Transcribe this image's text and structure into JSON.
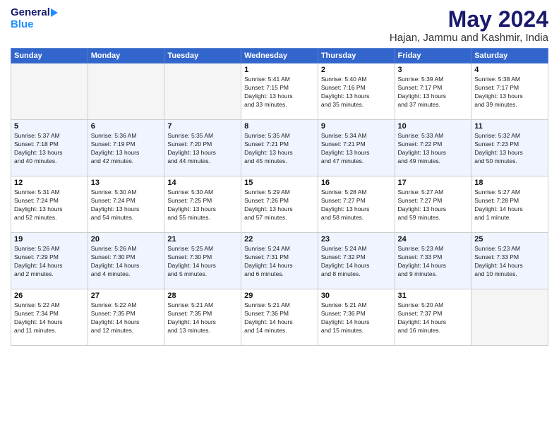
{
  "logo": {
    "general": "General",
    "blue": "Blue"
  },
  "title": "May 2024",
  "subtitle": "Hajan, Jammu and Kashmir, India",
  "weekdays": [
    "Sunday",
    "Monday",
    "Tuesday",
    "Wednesday",
    "Thursday",
    "Friday",
    "Saturday"
  ],
  "weeks": [
    [
      {
        "day": "",
        "info": ""
      },
      {
        "day": "",
        "info": ""
      },
      {
        "day": "",
        "info": ""
      },
      {
        "day": "1",
        "info": "Sunrise: 5:41 AM\nSunset: 7:15 PM\nDaylight: 13 hours\nand 33 minutes."
      },
      {
        "day": "2",
        "info": "Sunrise: 5:40 AM\nSunset: 7:16 PM\nDaylight: 13 hours\nand 35 minutes."
      },
      {
        "day": "3",
        "info": "Sunrise: 5:39 AM\nSunset: 7:17 PM\nDaylight: 13 hours\nand 37 minutes."
      },
      {
        "day": "4",
        "info": "Sunrise: 5:38 AM\nSunset: 7:17 PM\nDaylight: 13 hours\nand 39 minutes."
      }
    ],
    [
      {
        "day": "5",
        "info": "Sunrise: 5:37 AM\nSunset: 7:18 PM\nDaylight: 13 hours\nand 40 minutes."
      },
      {
        "day": "6",
        "info": "Sunrise: 5:36 AM\nSunset: 7:19 PM\nDaylight: 13 hours\nand 42 minutes."
      },
      {
        "day": "7",
        "info": "Sunrise: 5:35 AM\nSunset: 7:20 PM\nDaylight: 13 hours\nand 44 minutes."
      },
      {
        "day": "8",
        "info": "Sunrise: 5:35 AM\nSunset: 7:21 PM\nDaylight: 13 hours\nand 45 minutes."
      },
      {
        "day": "9",
        "info": "Sunrise: 5:34 AM\nSunset: 7:21 PM\nDaylight: 13 hours\nand 47 minutes."
      },
      {
        "day": "10",
        "info": "Sunrise: 5:33 AM\nSunset: 7:22 PM\nDaylight: 13 hours\nand 49 minutes."
      },
      {
        "day": "11",
        "info": "Sunrise: 5:32 AM\nSunset: 7:23 PM\nDaylight: 13 hours\nand 50 minutes."
      }
    ],
    [
      {
        "day": "12",
        "info": "Sunrise: 5:31 AM\nSunset: 7:24 PM\nDaylight: 13 hours\nand 52 minutes."
      },
      {
        "day": "13",
        "info": "Sunrise: 5:30 AM\nSunset: 7:24 PM\nDaylight: 13 hours\nand 54 minutes."
      },
      {
        "day": "14",
        "info": "Sunrise: 5:30 AM\nSunset: 7:25 PM\nDaylight: 13 hours\nand 55 minutes."
      },
      {
        "day": "15",
        "info": "Sunrise: 5:29 AM\nSunset: 7:26 PM\nDaylight: 13 hours\nand 57 minutes."
      },
      {
        "day": "16",
        "info": "Sunrise: 5:28 AM\nSunset: 7:27 PM\nDaylight: 13 hours\nand 58 minutes."
      },
      {
        "day": "17",
        "info": "Sunrise: 5:27 AM\nSunset: 7:27 PM\nDaylight: 13 hours\nand 59 minutes."
      },
      {
        "day": "18",
        "info": "Sunrise: 5:27 AM\nSunset: 7:28 PM\nDaylight: 14 hours\nand 1 minute."
      }
    ],
    [
      {
        "day": "19",
        "info": "Sunrise: 5:26 AM\nSunset: 7:29 PM\nDaylight: 14 hours\nand 2 minutes."
      },
      {
        "day": "20",
        "info": "Sunrise: 5:26 AM\nSunset: 7:30 PM\nDaylight: 14 hours\nand 4 minutes."
      },
      {
        "day": "21",
        "info": "Sunrise: 5:25 AM\nSunset: 7:30 PM\nDaylight: 14 hours\nand 5 minutes."
      },
      {
        "day": "22",
        "info": "Sunrise: 5:24 AM\nSunset: 7:31 PM\nDaylight: 14 hours\nand 6 minutes."
      },
      {
        "day": "23",
        "info": "Sunrise: 5:24 AM\nSunset: 7:32 PM\nDaylight: 14 hours\nand 8 minutes."
      },
      {
        "day": "24",
        "info": "Sunrise: 5:23 AM\nSunset: 7:33 PM\nDaylight: 14 hours\nand 9 minutes."
      },
      {
        "day": "25",
        "info": "Sunrise: 5:23 AM\nSunset: 7:33 PM\nDaylight: 14 hours\nand 10 minutes."
      }
    ],
    [
      {
        "day": "26",
        "info": "Sunrise: 5:22 AM\nSunset: 7:34 PM\nDaylight: 14 hours\nand 11 minutes."
      },
      {
        "day": "27",
        "info": "Sunrise: 5:22 AM\nSunset: 7:35 PM\nDaylight: 14 hours\nand 12 minutes."
      },
      {
        "day": "28",
        "info": "Sunrise: 5:21 AM\nSunset: 7:35 PM\nDaylight: 14 hours\nand 13 minutes."
      },
      {
        "day": "29",
        "info": "Sunrise: 5:21 AM\nSunset: 7:36 PM\nDaylight: 14 hours\nand 14 minutes."
      },
      {
        "day": "30",
        "info": "Sunrise: 5:21 AM\nSunset: 7:36 PM\nDaylight: 14 hours\nand 15 minutes."
      },
      {
        "day": "31",
        "info": "Sunrise: 5:20 AM\nSunset: 7:37 PM\nDaylight: 14 hours\nand 16 minutes."
      },
      {
        "day": "",
        "info": ""
      }
    ]
  ]
}
